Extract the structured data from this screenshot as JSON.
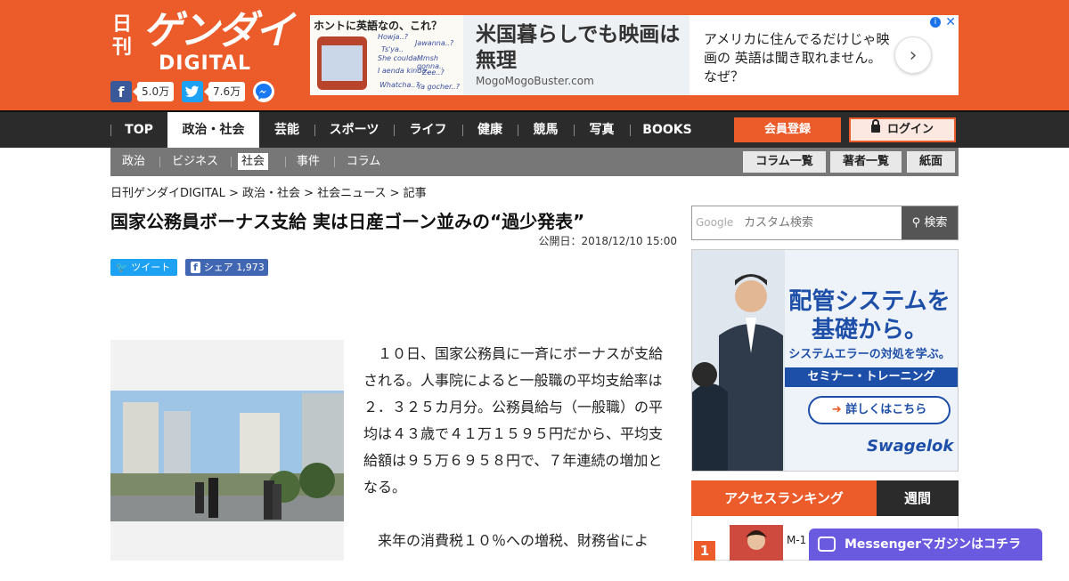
{
  "header": {
    "logo_nikkan": "日刊",
    "logo_gendai": "ゲンダイ",
    "logo_digital": "DIGITAL",
    "fb_count": "5.0万",
    "tw_count": "7.6万"
  },
  "ad_top": {
    "image_heading": "ホントに英語なの、これ？",
    "image_words": [
      "Howja..?",
      "Jawanna..?",
      "Ts'ya..",
      "She coulda..",
      "Mmsh gonna..",
      "I aenda kinda..",
      "Zee..?",
      "Whatcha..?",
      "Ya gocher..?"
    ],
    "headline": "米国暮らしでも映画は無理",
    "url": "MogoMogoBuster.com",
    "description": "アメリカに住んでるだけじゃ映画の 英語は聞き取れません。なぜ？"
  },
  "nav": {
    "items": [
      "TOP",
      "政治・社会",
      "芸能",
      "スポーツ",
      "ライフ",
      "健康",
      "競馬",
      "写真",
      "BOOKS"
    ],
    "active_index": 1,
    "register": "会員登録",
    "login": "ログイン"
  },
  "subnav": {
    "items": [
      "政治",
      "ビジネス",
      "社会",
      "事件",
      "コラム"
    ],
    "active_index": 2,
    "buttons": [
      "コラム一覧",
      "著者一覧",
      "紙面"
    ]
  },
  "breadcrumb": "日刊ゲンダイDIGITAL > 政治・社会 > 社会ニュース > 記事",
  "article": {
    "title": "国家公務員ボーナス支給 実は日産ゴーン並みの“過少発表”",
    "published": "公開日：2018/12/10 15:00",
    "tweet_label": "ツイート",
    "share_label": "シェア",
    "share_count": "1,973",
    "paragraphs": [
      "１０日、国家公務員に一斉にボーナスが支給される。人事院によると一般職の平均支給率は２．３２５カ月分。公務員給与（一般職）の平均は４３歳で４１万１５９５円だから、平均支給額は９５万６９５８円で、７年連続の増加となる。",
      "来年の消費税１０％への増税、財務省によ"
    ]
  },
  "sidebar": {
    "search_brand": "Google",
    "search_placeholder": "カスタム検索",
    "search_button": "検索",
    "ad": {
      "headline_line1": "配管システムを",
      "headline_line2": "基礎から。",
      "sub": "システムエラーの対処を学ぶ。",
      "bar": "セミナー・トレーニング",
      "more": "詳しくはこちら",
      "brand": "Swagelok"
    },
    "ranking_title": "アクセスランキング",
    "ranking_tab": "週間",
    "rank1_num": "1",
    "rank1_text": "M-1"
  },
  "messenger_bar": "Messengerマガジンはコチラ",
  "colors": {
    "brand": "#ec5b2a",
    "nav_bg": "#2b2b2b",
    "subnav_bg": "#777777",
    "messenger": "#6a5ae0"
  }
}
